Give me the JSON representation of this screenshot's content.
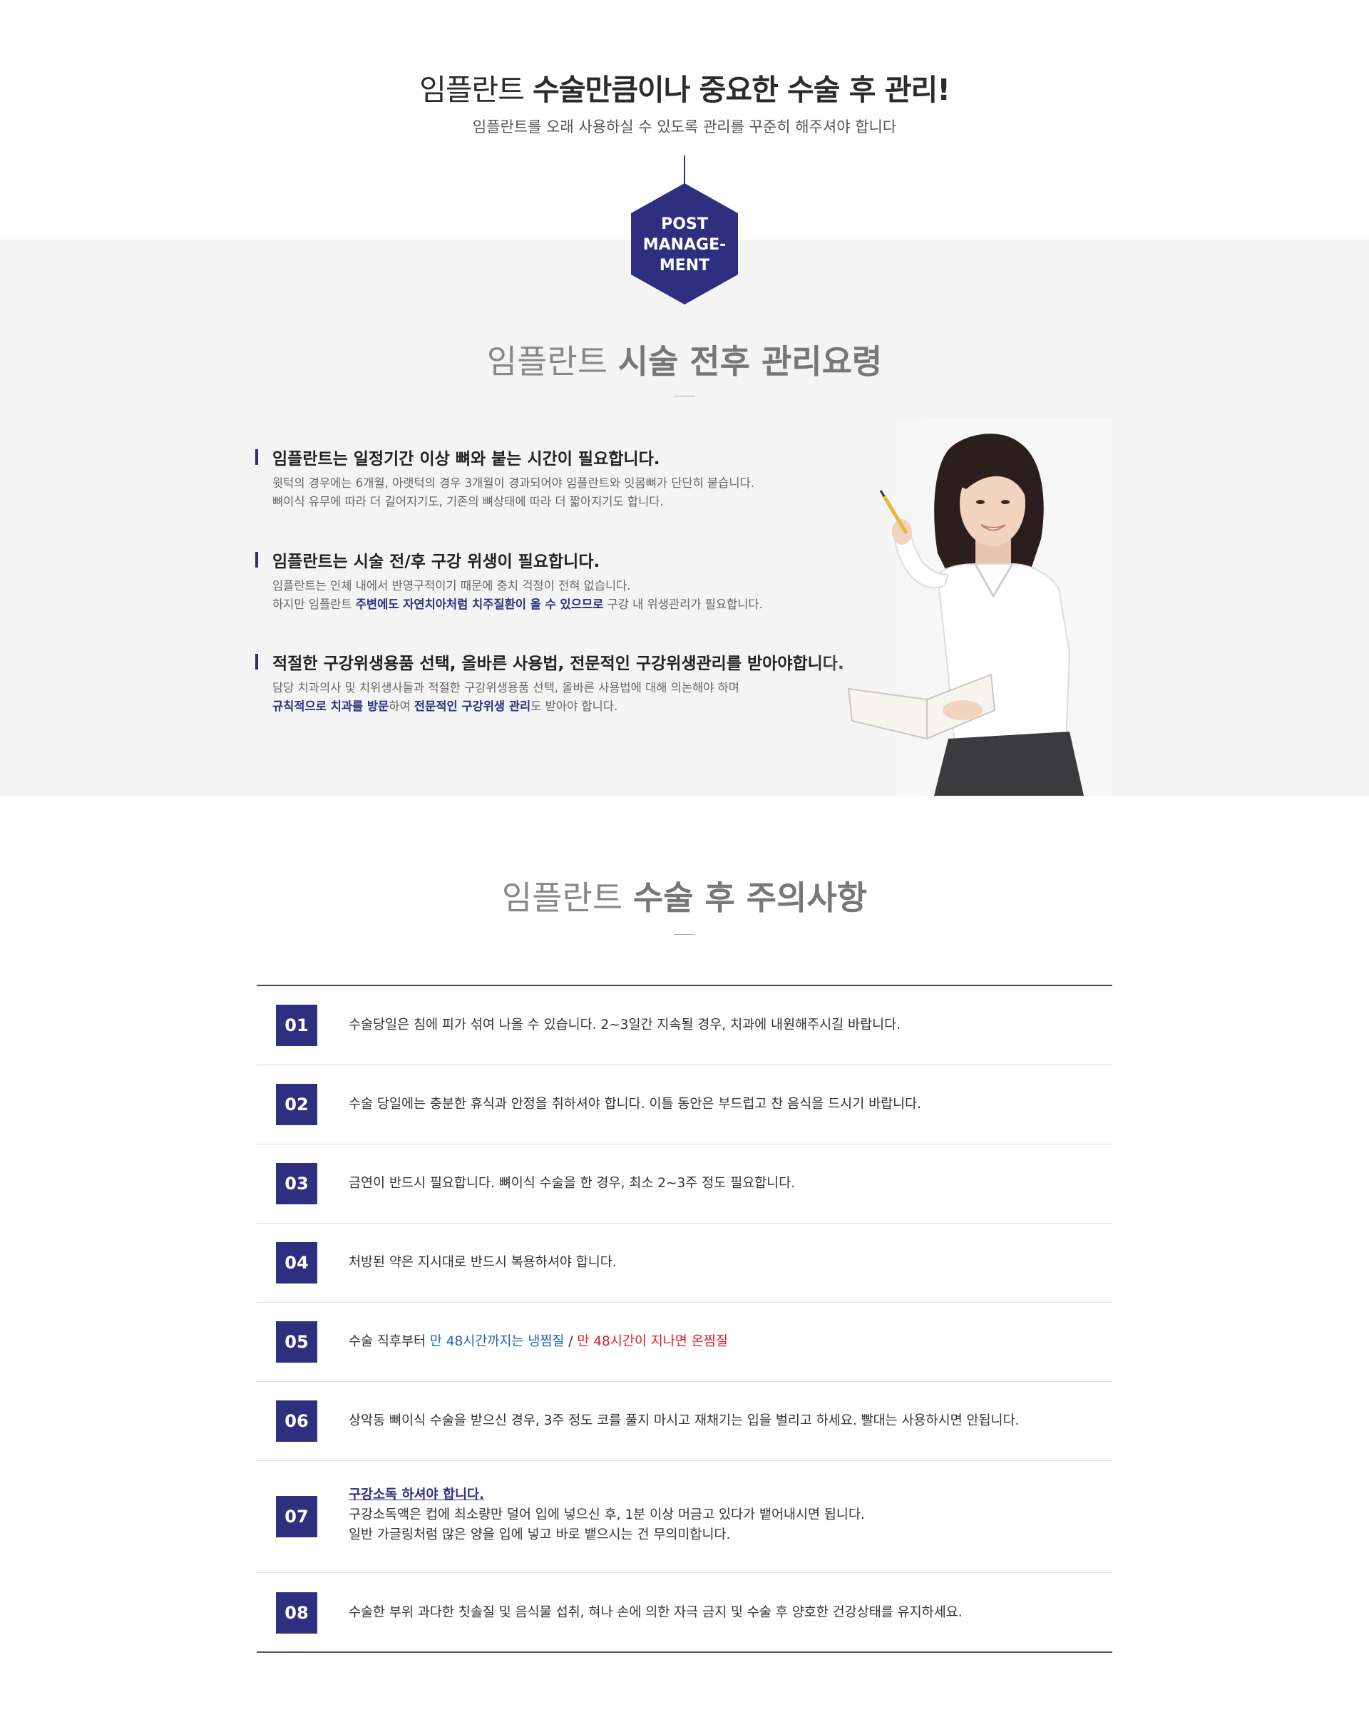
{
  "header": {
    "title_light": "임플란트",
    "title_bold": "수술만큼이나 중요한 수술 후 관리!",
    "subtitle": "임플란트를 오래 사용하실 수 있도록 관리를 꾸준히 해주셔야 합니다",
    "badge": "POST\nMANAGE-\nMENT"
  },
  "care": {
    "title_light": "임플란트",
    "title_bold": "시술 전후 관리요령",
    "items": [
      {
        "heading": "임플란트는 일정기간 이상 뼈와 붙는 시간이 필요합니다.",
        "line1": "윗턱의 경우에는 6개월, 아랫턱의 경우 3개월이 경과되어야 임플란트와 잇몸뼈가 단단히 붙습니다.",
        "line2": "뼈이식 유무에 따라 더 길어지기도, 기존의 뼈상태에 따라 더 짧아지기도 합니다."
      },
      {
        "heading": "임플란트는 시술 전/후 구강 위생이 필요합니다.",
        "line1": "임플란트는 인체 내에서 반영구적이기 때문에 충치 걱정이 전혀 없습니다.",
        "line2_a": "하지만 임플란트 ",
        "line2_hl": "주변에도 자연치아처럼 치주질환이 올 수 있으므로",
        "line2_b": " 구강 내 위생관리가 필요합니다."
      },
      {
        "heading": "적절한 구강위생용품 선택, 올바른 사용법, 전문적인 구강위생관리를 받아야합니다.",
        "line1": "담당 치과의사 및 치위생사들과 적절한 구강위생용품 선택, 올바른 사용법에 대해 의논해야 하며",
        "line2_hl1": "규칙적으로 치과를 방문",
        "line2_a": "하여 ",
        "line2_hl2": "전문적인 구강위생 관리",
        "line2_b": "도 받아야 합니다."
      }
    ]
  },
  "warnings": {
    "title_light": "임플란트",
    "title_bold": "수술 후 주의사항",
    "rows": [
      {
        "num": "01",
        "text": "수술당일은 침에 피가 섞여 나올 수 있습니다. 2~3일간 지속될 경우, 치과에 내원해주시길 바랍니다."
      },
      {
        "num": "02",
        "text": "수술 당일에는 충분한 휴식과 안정을 취하셔야 합니다. 이틀 동안은 부드럽고 찬 음식을 드시기 바랍니다."
      },
      {
        "num": "03",
        "text": "금연이 반드시 필요합니다. 뼈이식 수술을 한 경우, 최소 2~3주 정도 필요합니다."
      },
      {
        "num": "04",
        "text": "처방된 약은 지시대로 반드시 복용하셔야 합니다."
      },
      {
        "num": "05",
        "text_a": "수술 직후부터 ",
        "text_blue": "만 48시간까지는 냉찜질",
        "text_sep": " / ",
        "text_red": "만 48시간이 지나면 온찜질"
      },
      {
        "num": "06",
        "text": "상악동 뼈이식 수술을 받으신 경우, 3주 정도 코를 풀지 마시고 재채기는 입을 벌리고 하세요. 빨대는 사용하시면 안됩니다."
      },
      {
        "num": "07",
        "heading": "구강소독 하셔야 합니다.",
        "line1": "구강소독액은 컵에 최소량만 덜어 입에 넣으신 후, 1분 이상 머금고 있다가 뱉어내시면 됩니다.",
        "line2": "일반 가글링처럼 많은 양을 입에 넣고 바로 뱉으시는 건 무의미합니다."
      },
      {
        "num": "08",
        "text": "수술한 부위 과다한 칫솔질 및 음식물 섭취, 혀나 손에 의한 자극 금지 및 수술 후 양호한 건강상태를 유지하세요."
      }
    ]
  },
  "colors": {
    "navy": "#2e2f7f",
    "blue": "#1f5fb8",
    "red": "#d81b2a",
    "gray_bg": "#f4f4f4"
  }
}
